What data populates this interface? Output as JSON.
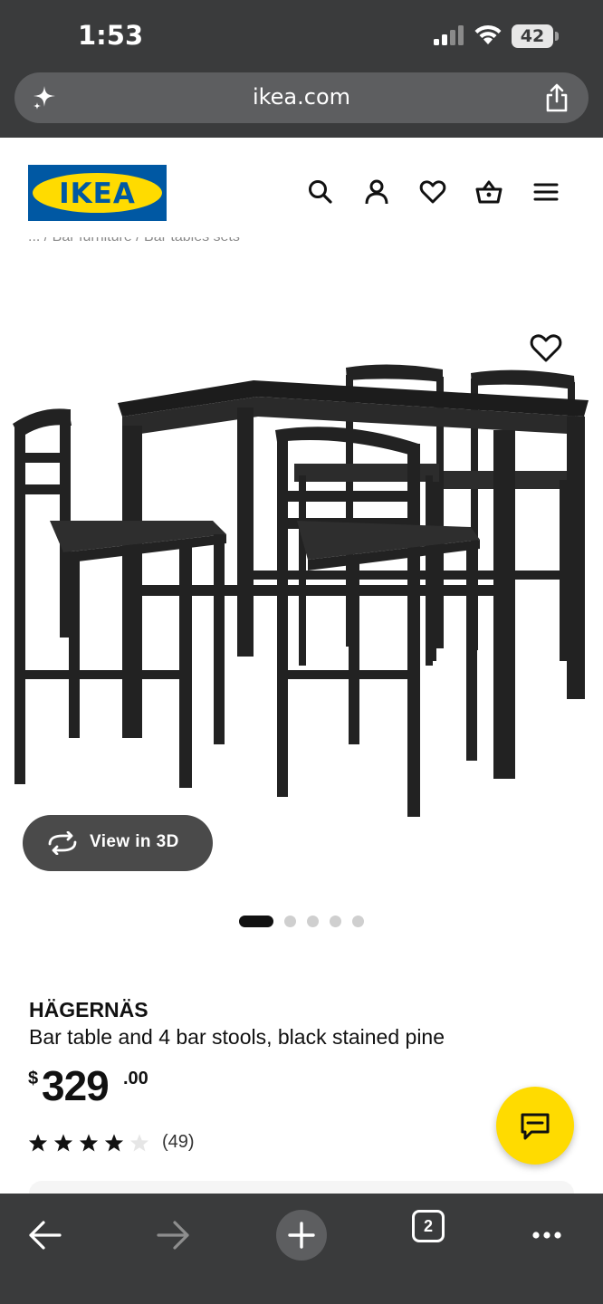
{
  "status_bar": {
    "time": "1:53",
    "battery": "42"
  },
  "browser": {
    "url": "ikea.com",
    "tab_count": "2"
  },
  "site": {
    "logo_text": "IKEA",
    "breadcrumb": "... / Bar furniture / Bar tables sets"
  },
  "product_gallery": {
    "view_3d_label": "View in 3D",
    "dot_count": 5,
    "active_index": 0
  },
  "product": {
    "name": "HÄGERNÄS",
    "description": "Bar table and 4 bar stools, black stained pine",
    "price_currency": "$",
    "price_whole": "329",
    "price_decimal": ".00",
    "rating": 4,
    "rating_max": 5,
    "review_count": "(49)"
  },
  "colors": {
    "ikea_blue": "#0058a3",
    "ikea_yellow": "#ffdb00",
    "browser_chrome": "#3a3b3c"
  },
  "icons": {
    "header": [
      "search-icon",
      "account-icon",
      "heart-icon",
      "basket-icon",
      "menu-icon"
    ],
    "toolbar": [
      "back-arrow-icon",
      "forward-arrow-icon",
      "plus-icon",
      "tabs-icon",
      "more-icon"
    ]
  }
}
